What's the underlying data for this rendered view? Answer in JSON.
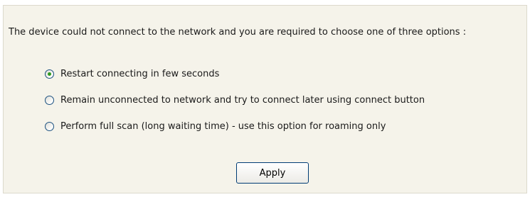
{
  "message": "The device could not connect to the network and you are required to choose one of three options :",
  "options": [
    {
      "label": "Restart connecting in few seconds",
      "selected": true
    },
    {
      "label": "Remain unconnected to network and try to connect later using connect button",
      "selected": false
    },
    {
      "label": "Perform full scan (long waiting time) - use this option for roaming only",
      "selected": false
    }
  ],
  "apply_button": {
    "label": "Apply"
  },
  "colors": {
    "panel_background": "#f5f3ea",
    "radio_checked_dot": "#2f9a1f",
    "button_border": "#003c74"
  }
}
